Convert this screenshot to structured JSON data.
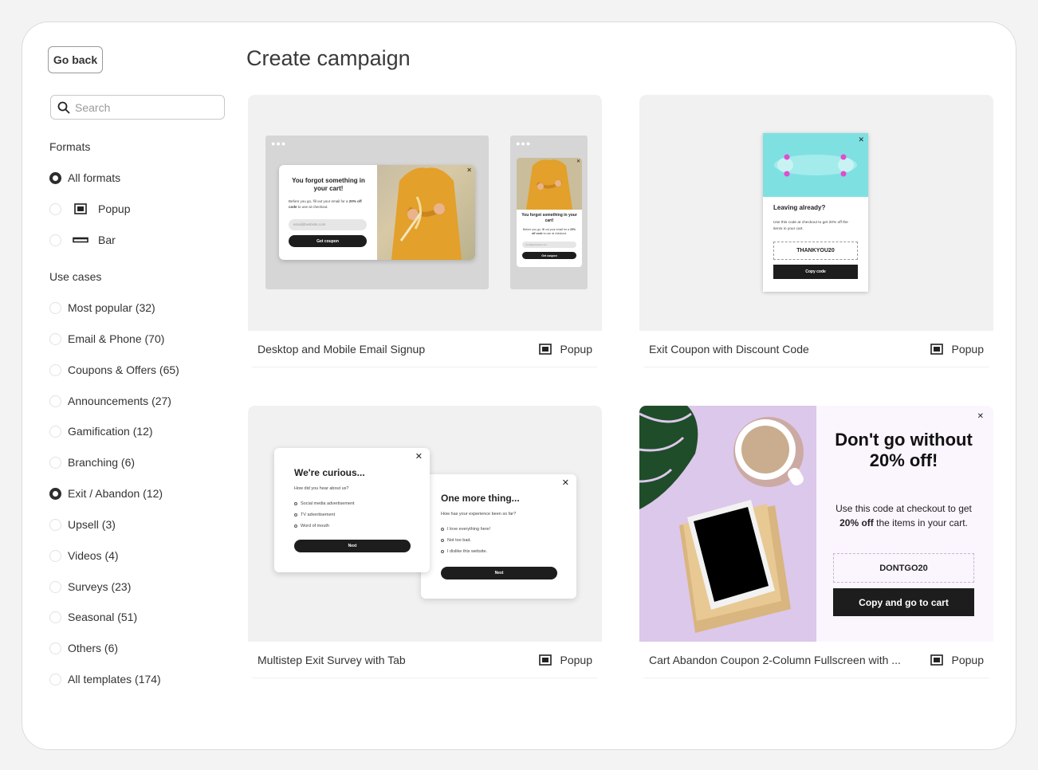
{
  "sidebar": {
    "go_back_label": "Go back",
    "search_placeholder": "Search",
    "formats_title": "Formats",
    "formats": [
      {
        "label": "All formats",
        "selected": true
      },
      {
        "label": "Popup",
        "selected": false,
        "icon": "popup-icon"
      },
      {
        "label": "Bar",
        "selected": false,
        "icon": "bar-icon"
      }
    ],
    "use_cases_title": "Use cases",
    "use_cases": [
      {
        "label": "Most popular (32)",
        "selected": false
      },
      {
        "label": "Email & Phone (70)",
        "selected": false
      },
      {
        "label": "Coupons & Offers (65)",
        "selected": false
      },
      {
        "label": "Announcements (27)",
        "selected": false
      },
      {
        "label": "Gamification (12)",
        "selected": false
      },
      {
        "label": "Branching (6)",
        "selected": false
      },
      {
        "label": "Exit / Abandon (12)",
        "selected": true
      },
      {
        "label": "Upsell (3)",
        "selected": false
      },
      {
        "label": "Videos (4)",
        "selected": false
      },
      {
        "label": "Surveys (23)",
        "selected": false
      },
      {
        "label": "Seasonal (51)",
        "selected": false
      },
      {
        "label": "Others (6)",
        "selected": false
      },
      {
        "label": "All templates (174)",
        "selected": false
      }
    ]
  },
  "main": {
    "title": "Create campaign",
    "cards": [
      {
        "name": "Desktop and Mobile Email Signup",
        "type": "Popup"
      },
      {
        "name": "Exit Coupon with Discount Code",
        "type": "Popup"
      },
      {
        "name": "Multistep Exit Survey with Tab",
        "type": "Popup"
      },
      {
        "name": "Cart Abandon Coupon 2-Column Fullscreen with ...",
        "type": "Popup"
      }
    ]
  },
  "previews": {
    "signup": {
      "heading": "You forgot something in your cart!",
      "body_pre": "Before you go, fill out your email for a ",
      "body_bold": "20% off code",
      "body_post": " to use at checkout.",
      "email_placeholder": "email@website.com",
      "button": "Get coupon",
      "mobile_heading": "You forgot something in your cart!",
      "mobile_body_pre": "Before you go, fill out your email for a ",
      "mobile_body_bold": "20% off code",
      "mobile_body_post": " to use at checkout."
    },
    "exit_coupon": {
      "heading": "Leaving already?",
      "body": "Use this code at checkout to get 20% off the items in your cart.",
      "code": "THANKYOU20",
      "button": "Copy code"
    },
    "survey": {
      "step1_title": "We're curious...",
      "step1_question": "How did you hear about us?",
      "step1_options": [
        "Social media advertisement",
        "TV advertisement",
        "Word of mouth"
      ],
      "step1_button": "Next",
      "step2_title": "One more thing...",
      "step2_question": "How has your experience been so far?",
      "step2_options": [
        "I love everything here!",
        "Not too bad.",
        "I dislike this website."
      ],
      "step2_button": "Next"
    },
    "cart_coupon": {
      "headline": "Don't go without 20% off!",
      "body_pre": "Use this code at checkout to get ",
      "body_bold": "20% off",
      "body_post": " the items in your cart.",
      "code": "DONTGO20",
      "button": "Copy and go to cart"
    }
  },
  "colors": {
    "dark_button": "#1d1d1d",
    "coat_yellow": "#e3a02a",
    "coupon_cyan": "#7fe0e2",
    "lavender": "#dcc8ea"
  }
}
